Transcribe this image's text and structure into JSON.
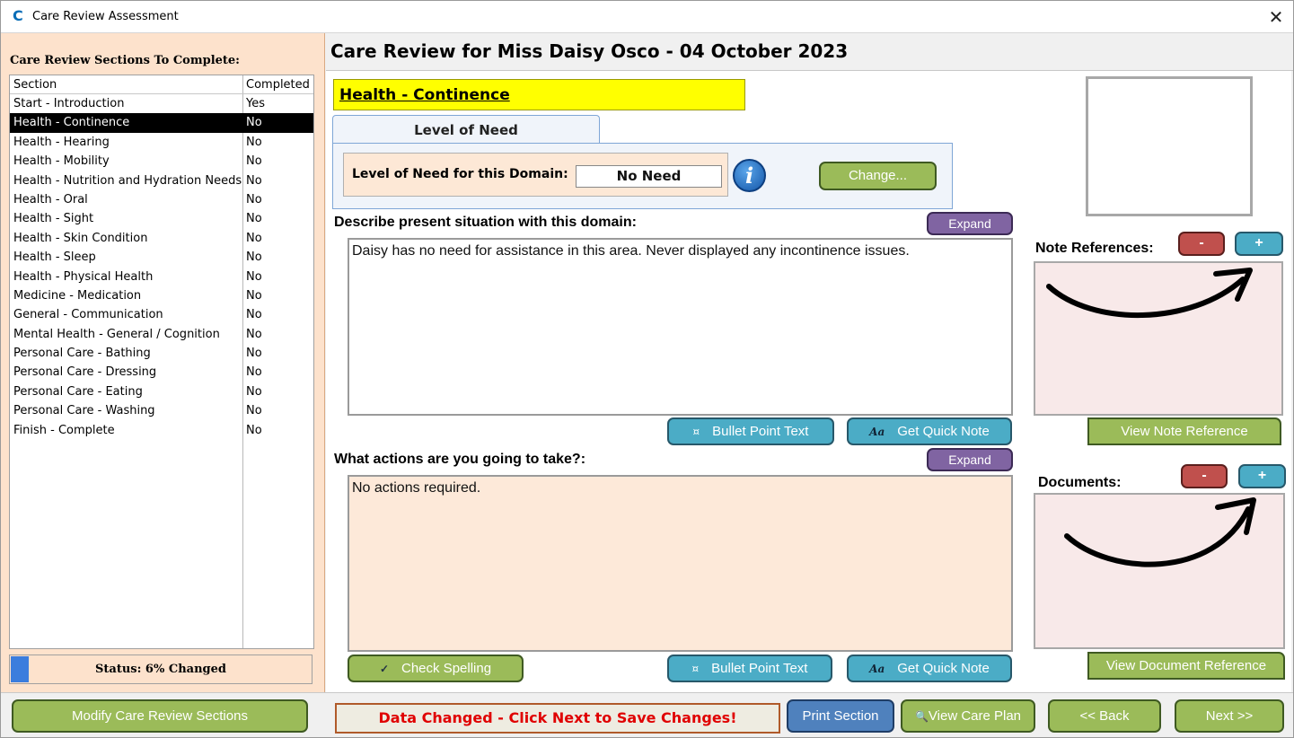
{
  "window": {
    "title": "Care Review Assessment",
    "close_glyph": "✕",
    "app_icon": "C"
  },
  "left": {
    "heading": "Care Review Sections To Complete:",
    "columns": {
      "section": "Section",
      "completed": "Completed"
    },
    "rows": [
      {
        "section": "Start - Introduction",
        "completed": "Yes"
      },
      {
        "section": "Health - Continence",
        "completed": "No"
      },
      {
        "section": "Health - Hearing",
        "completed": "No"
      },
      {
        "section": "Health - Mobility",
        "completed": "No"
      },
      {
        "section": "Health - Nutrition and Hydration Needs",
        "completed": "No"
      },
      {
        "section": "Health - Oral",
        "completed": "No"
      },
      {
        "section": "Health - Sight",
        "completed": "No"
      },
      {
        "section": "Health - Skin Condition",
        "completed": "No"
      },
      {
        "section": "Health - Sleep",
        "completed": "No"
      },
      {
        "section": "Health - Physical Health",
        "completed": "No"
      },
      {
        "section": "Medicine - Medication",
        "completed": "No"
      },
      {
        "section": "General - Communication",
        "completed": "No"
      },
      {
        "section": "Mental Health - General / Cognition",
        "completed": "No"
      },
      {
        "section": "Personal Care - Bathing",
        "completed": "No"
      },
      {
        "section": "Personal Care - Dressing",
        "completed": "No"
      },
      {
        "section": "Personal Care - Eating",
        "completed": "No"
      },
      {
        "section": "Personal Care - Washing",
        "completed": "No"
      },
      {
        "section": "Finish - Complete",
        "completed": "No"
      }
    ],
    "selected_index": 1,
    "status": {
      "text": "Status: 6% Changed",
      "progress_percent": 6
    }
  },
  "main": {
    "title": "Care Review for Miss Daisy Osco - 04 October 2023",
    "domain_title": "Health - Continence",
    "tab_label": "Level of Need",
    "need_label": "Level of Need for this Domain:",
    "need_value": "No Need",
    "info_glyph": "i",
    "change_label": "Change...",
    "situation_label": "Describe present situation with this domain:",
    "situation_text": "Daisy has no need for assistance in this area. Never displayed any incontinence issues.",
    "actions_label": "What actions are you going to take?:",
    "actions_text": "No actions required.",
    "expand_label": "Expand",
    "bullet_label": "Bullet Point Text",
    "bullet_icon": "¤",
    "quicknote_label": "Get Quick Note",
    "quicknote_icon": "Aa",
    "spelling_label": "Check Spelling",
    "spelling_icon": "✓"
  },
  "side": {
    "note_refs_label": "Note References:",
    "documents_label": "Documents:",
    "minus": "-",
    "plus": "+",
    "view_note_ref": "View Note Reference",
    "view_doc_ref": "View Document Reference"
  },
  "bottom": {
    "modify_label": "Modify Care Review Sections",
    "data_changed": "Data Changed - Click Next to Save Changes!",
    "print_label": "Print Section",
    "view_plan_label": "View Care Plan",
    "view_plan_icon": "🔍",
    "back_label": "<< Back",
    "next_label": "Next >>"
  },
  "colors": {
    "peach_panel": "#fde2cc",
    "highlight_yellow": "#ffff00",
    "green_button": "#9bbb59",
    "purple_button": "#8064a2",
    "teal_button": "#4bacc6",
    "red_button": "#c0504d",
    "blue_button": "#4f81bd",
    "warning_red": "#e00000"
  }
}
